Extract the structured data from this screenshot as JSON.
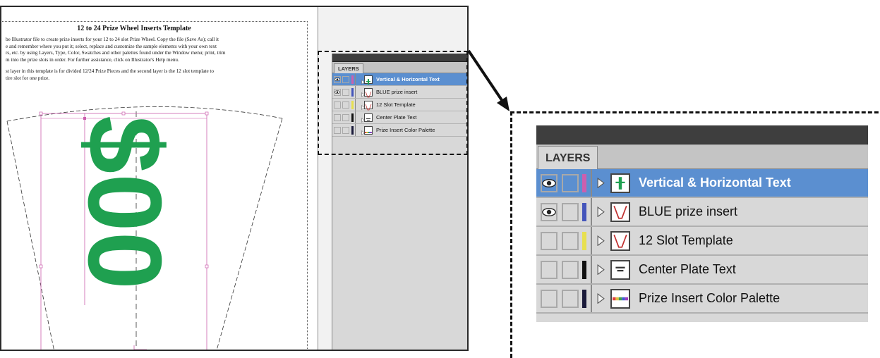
{
  "document": {
    "title": "12 to 24 Prize Wheel Inserts Template",
    "paragraph1": [
      "be Illustrator file to create prize inserts for your 12 to 24 slot Prize Wheel. Copy the file (Save As); call it",
      "e and remember where you put it; select, replace and customize the sample elements with your own text",
      "rs, etc. by using Layers, Type, Color, Swatches and other palettes found under the Window menu; print, trim",
      "m into the prize slots in order. For further assistance, click on Illustrator's Help menu."
    ],
    "paragraph2": [
      "st layer in this template is for divided 12/24 Prize Pieces and the second layer is the 12 slot template to",
      "tire slot for one prize."
    ],
    "insert_text": "$00",
    "insert_color": "#1fa050"
  },
  "layers_panel": {
    "tab_label": "LAYERS",
    "selected_color": "#5b8fd0",
    "layers": [
      {
        "name": "Vertical & Horizontal Text",
        "visible": true,
        "color": "#cc5fae",
        "thumb": "text-thumb-icon",
        "selected": true
      },
      {
        "name": "BLUE prize insert",
        "visible": true,
        "color": "#4455bb",
        "thumb": "prize-insert-thumb-icon",
        "selected": false
      },
      {
        "name": "12 Slot Template",
        "visible": false,
        "color": "#e8e050",
        "thumb": "slot-template-thumb-icon",
        "selected": false
      },
      {
        "name": "Center Plate Text",
        "visible": false,
        "color": "#111111",
        "thumb": "center-plate-thumb-icon",
        "selected": false
      },
      {
        "name": "Prize Insert Color Palette",
        "visible": false,
        "color": "#1a1a3a",
        "thumb": "color-palette-thumb-icon",
        "selected": false
      }
    ]
  },
  "icons": {
    "visibility": "eye-icon",
    "expand": "triangle-right-icon"
  }
}
